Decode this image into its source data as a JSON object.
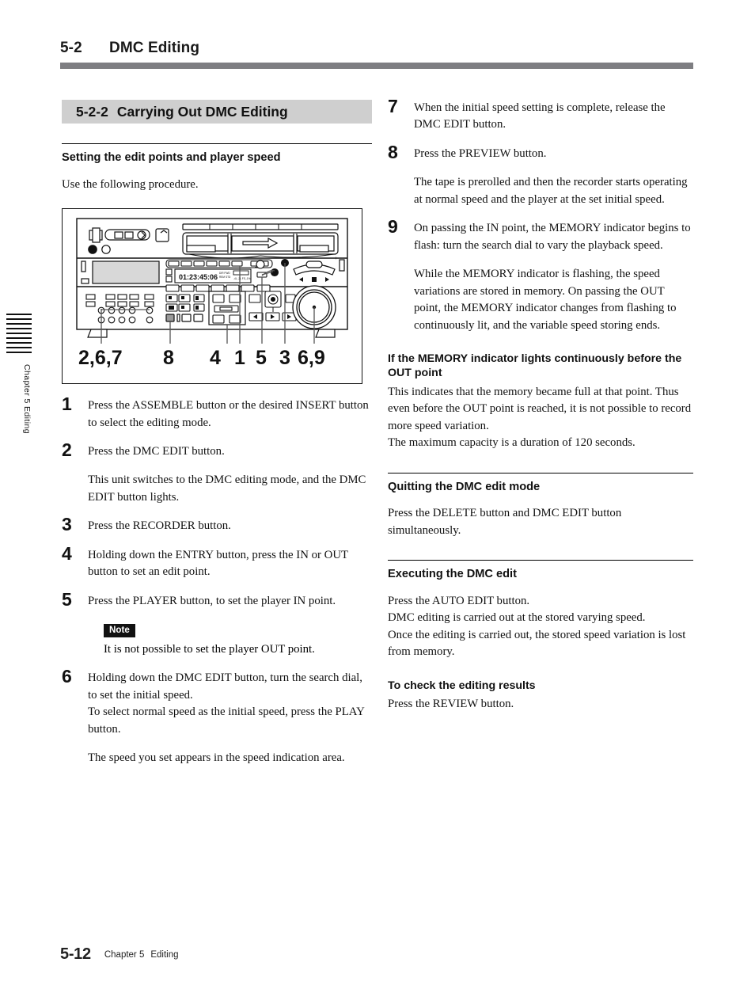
{
  "running_head": {
    "number": "5-2",
    "title": "DMC Editing"
  },
  "chapter_tab": {
    "label": "Chapter 5    Editing",
    "bar_count": 9
  },
  "section": {
    "number": "5-2-2",
    "title": "Carrying Out DMC Editing"
  },
  "left_column": {
    "heading": "Setting the edit points and player speed",
    "intro": "Use the following procedure.",
    "figure": {
      "caption_numbers": [
        "2,6,7",
        "8",
        "4",
        "1",
        "5",
        "3",
        "6,9"
      ],
      "timecode_display": "01:23:45:06",
      "alt": "Front panel of the video tape recorder with callout leader lines to the ASSEMBLE/INSERT buttons, DMC EDIT button, ENTRY/IN/OUT buttons, PLAYER button, RECORDER button and search dial"
    },
    "steps": [
      {
        "number": "1",
        "text": "Press the ASSEMBLE button or the desired INSERT button to select the editing mode.",
        "sub": ""
      },
      {
        "number": "2",
        "text": "Press the DMC EDIT button.",
        "sub": "This unit switches to the DMC editing mode, and the DMC EDIT button lights."
      },
      {
        "number": "3",
        "text": "Press the RECORDER button.",
        "sub": ""
      },
      {
        "number": "4",
        "text": "Holding down the ENTRY button, press the IN or OUT button to set an edit point.",
        "sub": ""
      },
      {
        "number": "5",
        "text": "Press the PLAYER button, to set the player IN point.",
        "sub": "",
        "note": {
          "badge": "Note",
          "body": "It is not possible to set the player OUT point."
        }
      },
      {
        "number": "6",
        "text": "Holding down the DMC EDIT button, turn the search dial, to set the initial speed.\nTo select normal speed as the initial speed, press the PLAY button.",
        "sub": "The speed you set appears in the speed indication area."
      }
    ]
  },
  "right_column": {
    "steps": [
      {
        "number": "7",
        "text": "When the initial speed setting is complete, release the DMC EDIT button.",
        "sub": ""
      },
      {
        "number": "8",
        "text": "Press the PREVIEW button.",
        "sub": "The tape is prerolled and then the recorder starts operating at normal speed and the player at the set initial speed."
      },
      {
        "number": "9",
        "text": "On passing the IN point, the MEMORY indicator begins to flash: turn the search dial to vary the playback speed.",
        "sub": "While the MEMORY indicator is flashing, the speed variations are stored in memory. On passing the OUT point, the MEMORY indicator changes from flashing to continuously lit, and the variable speed storing ends."
      }
    ],
    "memory_note": {
      "heading": "If the MEMORY indicator lights continuously before the OUT point",
      "body": "This indicates that the memory became full at that point. Thus even before the OUT point is reached, it is not possible to record more speed variation.\nThe maximum capacity is a duration of 120 seconds."
    },
    "quitting": {
      "heading": "Quitting the DMC edit mode",
      "body": "Press the DELETE button and DMC EDIT button simultaneously."
    },
    "executing": {
      "heading": "Executing the DMC edit",
      "body": "Press the AUTO EDIT button.\nDMC editing is carried out at the stored varying speed.\nOnce the editing is carried out, the stored speed variation is lost from memory.",
      "sub_heading": "To check the editing results",
      "sub_body": "Press the REVIEW button."
    }
  },
  "footer": {
    "page_number": "5-12",
    "chapter": "Chapter 5",
    "section": "Editing"
  },
  "colors": {
    "rule_gray": "#7e7e82",
    "section_bar_gray": "#cfcfcf",
    "ink": "#111111"
  }
}
